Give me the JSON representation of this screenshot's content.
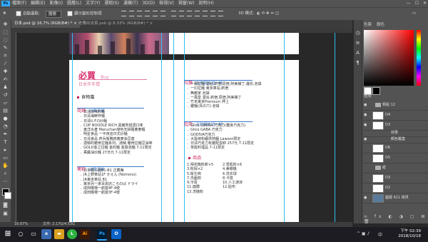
{
  "menu": {
    "logo": "Ps",
    "items": [
      "檔案(F)",
      "編輯(E)",
      "影像(I)",
      "圖層(L)",
      "文字(Y)",
      "選取(S)",
      "濾鏡(T)",
      "3D(D)",
      "檢視(V)",
      "視窗(W)",
      "說明(H)"
    ]
  },
  "options": {
    "auto_select_label": "自動選取:",
    "auto_select_value": "圖層",
    "transform_label": "顯示變形控制項",
    "mode3d": "3D 模式:"
  },
  "tabs": [
    {
      "label": "日本.psd @ 16.7% (RGB/8#) *",
      "close": "×"
    },
    {
      "label": "老購出去頁.psb @ 8.33% (RGB/8#) *",
      "close": "×"
    }
  ],
  "status": {
    "zoom": "16.67%",
    "doc": "文件: 2.17G/4.53G"
  },
  "panels": {
    "color_tab": "色票",
    "color_tab2": "顏色",
    "layers_tab": "圖層"
  },
  "layers": [
    {
      "name": "類組 12",
      "eye": "●"
    },
    {
      "name": "D4",
      "eye": "●"
    },
    {
      "name": "D3",
      "eye": "●"
    },
    {
      "name": "效果",
      "eye": ""
    },
    {
      "name": "顏色覆蓋",
      "eye": "●"
    },
    {
      "name": "D6",
      "eye": ""
    },
    {
      "name": "D5",
      "eye": ""
    },
    {
      "name": "紙",
      "eye": ""
    },
    {
      "name": "D3",
      "eye": ""
    },
    {
      "name": "D2",
      "eye": ""
    },
    {
      "name": "圖層 621 拷貝",
      "eye": "●"
    }
  ],
  "page_left": {
    "title": "必買",
    "title_en": "Buy",
    "subtitle": "日本伴手禮",
    "section": "食物篇",
    "tag1": "商鋪",
    "tag1_sub": "必買清單",
    "list1": [
      "．日清泡味料麵",
      "．日清海鮮杯麵",
      "．日清U.F.O炒麵",
      "．CUP NOODLE RICH 黑豬魚翅濃口味",
      "．東洋水產 Maruchan綠色天婦羅蕎麥麵",
      "．明星食品 一平夜店日式炒麵",
      "．日清食品 咚兵衛鴨肉蕎麥油豆腐",
      "．濃郁的豬骨拉麵系列，通稱 豬骨拉麵豆油味",
      "．GOLD金之拉麵 金的麵 金猿泡麵 7-11限定",
      "．萬醬油炒麵 27日元 7-11限定"
    ],
    "tag2": "藥粧",
    "tag2_sub": "必買清單",
    "list2": [
      "．日本橋三越B1-B1 正藏庵",
      "．JR上野車站1F かえん (Nomono)",
      "．JR東京車站 B1",
      "．東京另一家百貨店ころのば ドライ",
      "．成田機場一航廈4F-4號",
      "．成田機場一航廈3F-4號"
    ]
  },
  "page_right": {
    "tag1": "拉麵",
    "tag1_sub": "在地朋友這一味",
    "list1": [
      "．一蘭拉麵 澀谷,新宿,原宿,阿美橫丁,優衣,池袋",
      "．一幻拉麵 東京車站,新宿",
      "．無敵家 池袋",
      "．一風堂 澀谷,新宿,原宿,阿美橫丁",
      "．竹末東京Premium 押上",
      "．雞麵(鳥の穴) 池袋"
    ],
    "tag2": "超商",
    "tag2_sub": "在地朋友這一味",
    "list2": [
      "．Glico LIBERA 巧克力(糖身巧克力)",
      "．Glico GABA 巧克力",
      "．GODIVA巧克力",
      "．大阪燒粉醬供熱麵 Lawson限定",
      "．日清巧克力有雞配蛋餅 257元 7-11限定",
      "．常能料理品 7-11限定"
    ],
    "tag3": "商品",
    "col_left": [
      "1.相花機粉餅×5",
      "3.粉探×2",
      "5.衛生棉",
      "7.洗面劑",
      "9.污膏",
      "11.面膜",
      "13.洗機粉"
    ],
    "col_right": [
      "2.雪肌粉×6",
      "4.美眼機",
      "6.洗衣球",
      "8.卡搭",
      "10.人工淚液",
      "12.貼布"
    ]
  },
  "taskbar": {
    "time": "下午 02:39",
    "date": "2018/10/18",
    "lang": "中"
  }
}
